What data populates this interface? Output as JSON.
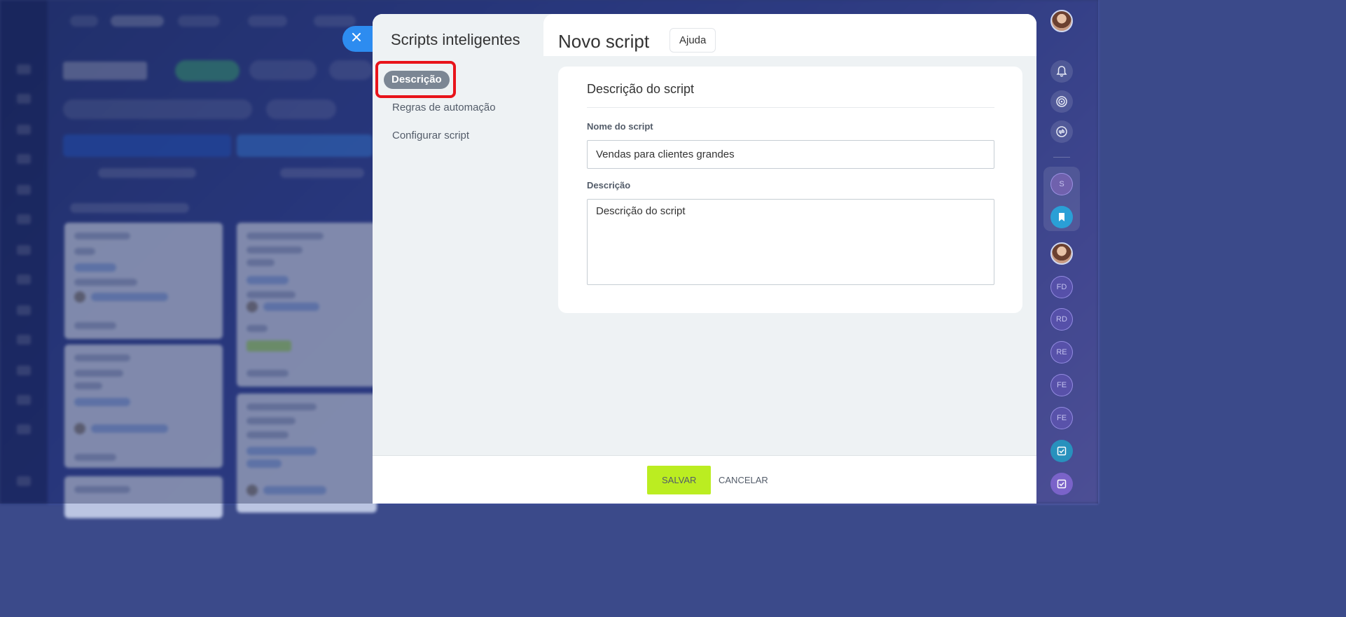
{
  "colors": {
    "accent_blue": "#2d8cf0",
    "save_green": "#bbed21",
    "highlight_red": "#e8141b",
    "active_pill": "#7b8694"
  },
  "close_tab": {
    "icon": "close-icon"
  },
  "sidebar": {
    "title": "Scripts inteligentes",
    "items": [
      {
        "label": "Descrição",
        "active": true
      },
      {
        "label": "Regras de automação",
        "active": false
      },
      {
        "label": "Configurar script",
        "active": false
      }
    ]
  },
  "header": {
    "title": "Novo script",
    "help_label": "Ajuda"
  },
  "form": {
    "section_title": "Descrição do script",
    "name_label": "Nome do script",
    "name_value": "Vendas para clientes grandes",
    "description_label": "Descrição",
    "description_value": "Descrição do script"
  },
  "footer": {
    "save_label": "SALVAR",
    "cancel_label": "CANCELAR"
  },
  "right_rail": {
    "icons": [
      "user-avatar",
      "bell-icon",
      "target-icon",
      "sync-icon",
      "bookmark-icon",
      "task-icon",
      "task-icon"
    ],
    "initials": [
      "S",
      "FD",
      "RD",
      "RE",
      "FE",
      "FE"
    ]
  }
}
